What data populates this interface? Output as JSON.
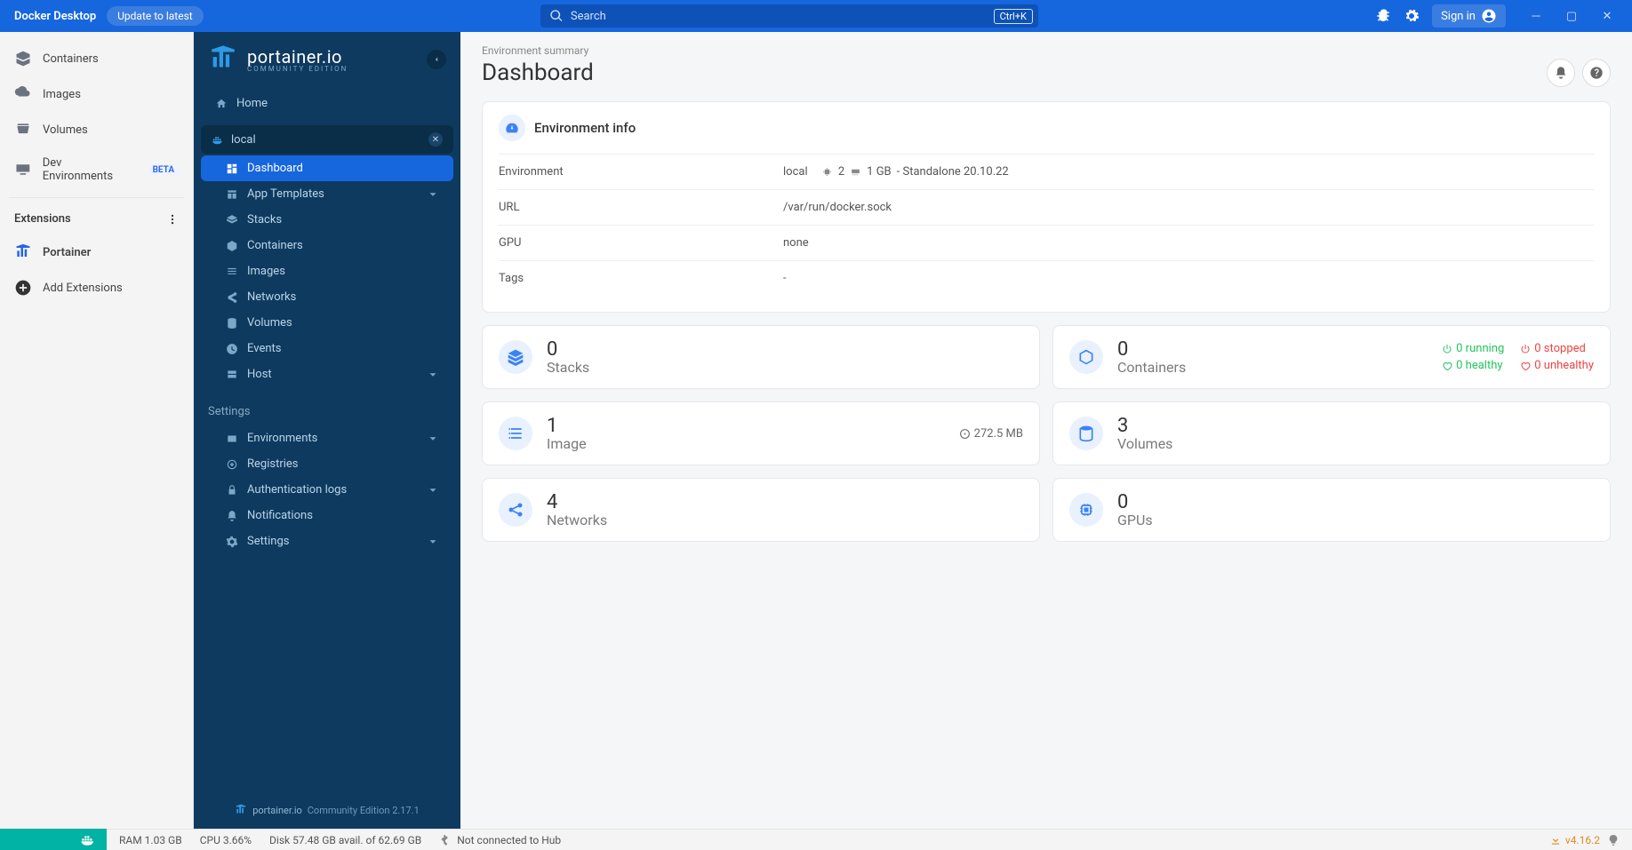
{
  "titlebar": {
    "app_name": "Docker Desktop",
    "update_label": "Update to latest",
    "search_placeholder": "Search",
    "search_kbd": "Ctrl+K",
    "signin_label": "Sign in"
  },
  "dd_sidebar": {
    "items": [
      {
        "label": "Containers"
      },
      {
        "label": "Images"
      },
      {
        "label": "Volumes"
      },
      {
        "label": "Dev Environments"
      }
    ],
    "beta_tag": "BETA",
    "extensions_header": "Extensions",
    "portainer_label": "Portainer",
    "add_extensions_label": "Add Extensions"
  },
  "pt_sidebar": {
    "brand": "portainer.io",
    "brand_sub": "COMMUNITY EDITION",
    "home_label": "Home",
    "env_name": "local",
    "menu": [
      {
        "label": "Dashboard",
        "active": true
      },
      {
        "label": "App Templates",
        "chevron": true
      },
      {
        "label": "Stacks"
      },
      {
        "label": "Containers"
      },
      {
        "label": "Images"
      },
      {
        "label": "Networks"
      },
      {
        "label": "Volumes"
      },
      {
        "label": "Events"
      },
      {
        "label": "Host",
        "chevron": true
      }
    ],
    "settings_label": "Settings",
    "settings_menu": [
      {
        "label": "Environments",
        "chevron": true
      },
      {
        "label": "Registries"
      },
      {
        "label": "Authentication logs",
        "chevron": true
      },
      {
        "label": "Notifications"
      },
      {
        "label": "Settings",
        "chevron": true
      }
    ],
    "footer_brand": "portainer.io",
    "footer_text": "Community Edition 2.17.1"
  },
  "main": {
    "breadcrumb": "Environment summary",
    "page_title": "Dashboard",
    "env_card_title": "Environment info",
    "info_rows": {
      "env_label": "Environment",
      "env_value": "local",
      "env_cpu": "2",
      "env_ram": "1 GB",
      "env_tail": "- Standalone 20.10.22",
      "url_label": "URL",
      "url_value": "/var/run/docker.sock",
      "gpu_label": "GPU",
      "gpu_value": "none",
      "tags_label": "Tags",
      "tags_value": "-"
    },
    "tiles": {
      "stacks_count": "0",
      "stacks_label": "Stacks",
      "containers_count": "0",
      "containers_label": "Containers",
      "running": "0 running",
      "stopped": "0 stopped",
      "healthy": "0 healthy",
      "unhealthy": "0 unhealthy",
      "images_count": "1",
      "images_label": "Image",
      "images_size": "272.5 MB",
      "volumes_count": "3",
      "volumes_label": "Volumes",
      "networks_count": "4",
      "networks_label": "Networks",
      "gpus_count": "0",
      "gpus_label": "GPUs"
    }
  },
  "statusbar": {
    "ram": "RAM 1.03 GB",
    "cpu": "CPU 3.66%",
    "disk": "Disk 57.48 GB avail. of 62.69 GB",
    "hub": "Not connected to Hub",
    "version": "v4.16.2"
  }
}
